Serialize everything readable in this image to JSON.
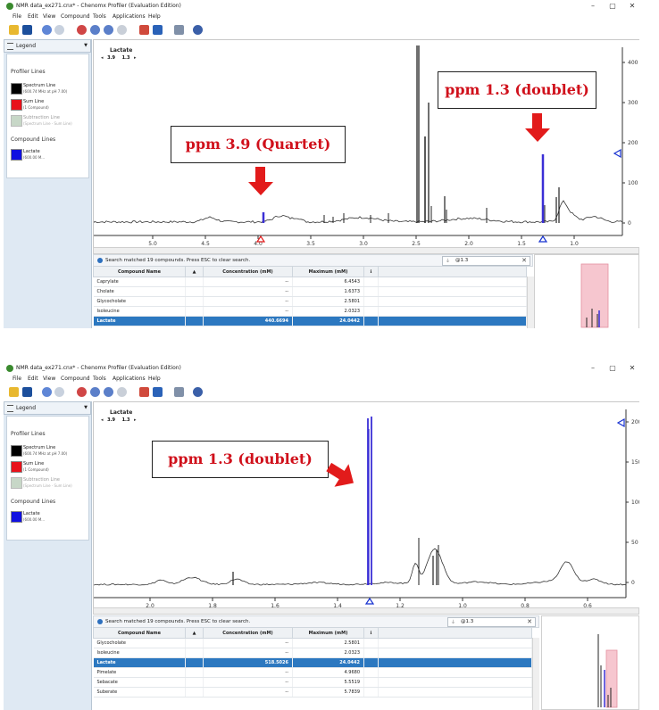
{
  "app": {
    "window_title": "NMR data_ex271.cnx* - Chenomx Profiler (Evaluation Edition)",
    "menu": [
      "File",
      "Edit",
      "View",
      "Compound",
      "Tools",
      "Applications",
      "Help"
    ],
    "window_controls": [
      "–",
      "▢",
      "✕"
    ],
    "toolbar_icons": [
      "open-icon",
      "save-icon",
      "undo-icon",
      "redo-icon",
      "zoom-in-icon",
      "zoom-out-icon",
      "zoom-fit-icon",
      "zoom-reset-icon",
      "layout-icon",
      "panel-icon",
      "columns-icon",
      "settings-icon"
    ]
  },
  "sidebar": {
    "header": "Legend",
    "profiler_lines_title": "Profiler Lines",
    "items": [
      {
        "label": "Spectrum Line",
        "sub": "(600.74 MHz at pH 7.00)",
        "color": "#000000"
      },
      {
        "label": "Sum Line",
        "sub": "(1 Compound)",
        "color": "#e8121b"
      },
      {
        "label": "Subtraction Line",
        "sub": "(Spectrum Line - Sum Line)",
        "color": "#c7d7c7"
      }
    ],
    "compound_lines_title": "Compound Lines",
    "compounds": [
      {
        "label": "Lactate",
        "sub": "(600.00 M...",
        "color": "#1010e0"
      }
    ]
  },
  "screens": [
    {
      "plot": {
        "compound": "Lactate",
        "nav": [
          "3.9",
          "1.3"
        ],
        "x_ticks": [
          "5.0",
          "4.5",
          "4.0",
          "3.5",
          "3.0",
          "2.5",
          "2.0",
          "1.5",
          "1.0"
        ],
        "y_ticks": [
          "400",
          "300",
          "200",
          "100",
          "0"
        ]
      },
      "annotations": [
        {
          "text": "ppm 3.9 (Quartet)"
        },
        {
          "text": "ppm 1.3 (doublet)"
        }
      ],
      "search": {
        "message": "Search matched 19 compounds.  Press ESC to clear search.",
        "query": "@1.3"
      },
      "table": {
        "headers": [
          "Compound Name",
          "▲",
          "Concentration (mM)",
          "Maximum (mM)",
          "ℹ"
        ],
        "rows": [
          {
            "name": "Caprylate",
            "conc": "--",
            "max": "6.4543",
            "selected": false
          },
          {
            "name": "Cholate",
            "conc": "--",
            "max": "1.6373",
            "selected": false
          },
          {
            "name": "Glycocholate",
            "conc": "--",
            "max": "2.5801",
            "selected": false
          },
          {
            "name": "Isoleucine",
            "conc": "--",
            "max": "2.0323",
            "selected": false
          },
          {
            "name": "Lactate",
            "conc": "440.6694",
            "max": "24.0442",
            "selected": true
          }
        ]
      }
    },
    {
      "plot": {
        "compound": "Lactate",
        "nav": [
          "3.9",
          "1.3"
        ],
        "x_ticks": [
          "2.0",
          "1.8",
          "1.6",
          "1.4",
          "1.2",
          "1.0",
          "0.8",
          "0.6"
        ],
        "y_ticks": [
          "200",
          "150",
          "100",
          "50",
          "0"
        ]
      },
      "annotations": [
        {
          "text": "ppm 1.3 (doublet)"
        }
      ],
      "search": {
        "message": "Search matched 19 compounds.  Press ESC to clear search.",
        "query": "@1.3"
      },
      "table": {
        "headers": [
          "Compound Name",
          "▲",
          "Concentration (mM)",
          "Maximum (mM)",
          "ℹ"
        ],
        "rows": [
          {
            "name": "Glycocholate",
            "conc": "--",
            "max": "2.5801",
            "selected": false
          },
          {
            "name": "Isoleucine",
            "conc": "--",
            "max": "2.0323",
            "selected": false
          },
          {
            "name": "Lactate",
            "conc": "518.5026",
            "max": "24.0442",
            "selected": true
          },
          {
            "name": "Pimelate",
            "conc": "--",
            "max": "4.9680",
            "selected": false
          },
          {
            "name": "Sebacate",
            "conc": "--",
            "max": "5.5519",
            "selected": false
          },
          {
            "name": "Suberate",
            "conc": "--",
            "max": "5.7839",
            "selected": false
          }
        ]
      }
    }
  ]
}
